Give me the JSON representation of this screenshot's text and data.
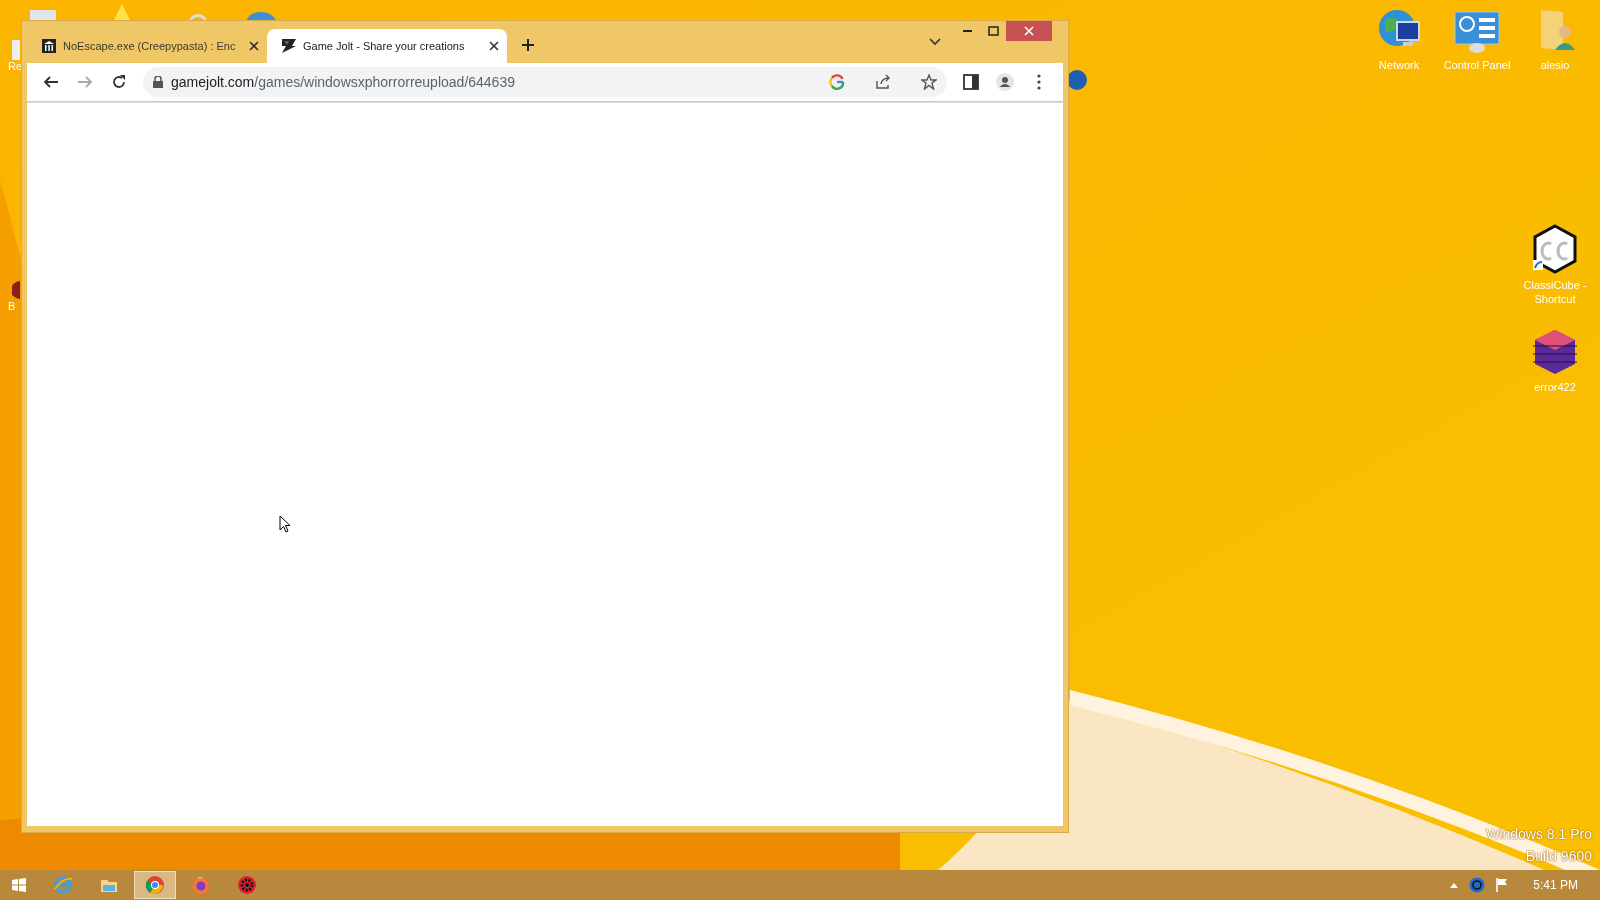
{
  "desktop": {
    "left_icons": [
      {
        "label": "Re"
      },
      {
        "label": "B"
      }
    ],
    "right_icons": [
      {
        "kind": "network",
        "label": "Network"
      },
      {
        "kind": "control-panel",
        "label": "Control Panel"
      },
      {
        "kind": "user-folder",
        "label": "alesio"
      },
      {
        "kind": "cube",
        "label": "ClassiCube - Shortcut"
      },
      {
        "kind": "glitch",
        "label": "error422"
      }
    ],
    "edition_text": [
      "Windows 8.1 Pro",
      "Build 9600"
    ]
  },
  "browser": {
    "tabs": [
      {
        "kind": "museum",
        "title": "NoEscape.exe (Creepypasta) : Enc",
        "selected": false
      },
      {
        "kind": "gamejolt",
        "title": "Game Jolt - Share your creations",
        "selected": true
      }
    ],
    "url": {
      "host": "gamejolt.com",
      "path": "/games/windowsxphorrorreupload/644639"
    }
  },
  "taskbar": {
    "apps": [
      {
        "kind": "ie",
        "selected": false
      },
      {
        "kind": "explorer",
        "selected": false
      },
      {
        "kind": "chrome",
        "selected": true
      },
      {
        "kind": "firefox",
        "selected": false
      },
      {
        "kind": "gear",
        "selected": false
      }
    ],
    "clock": "5:41 PM"
  }
}
